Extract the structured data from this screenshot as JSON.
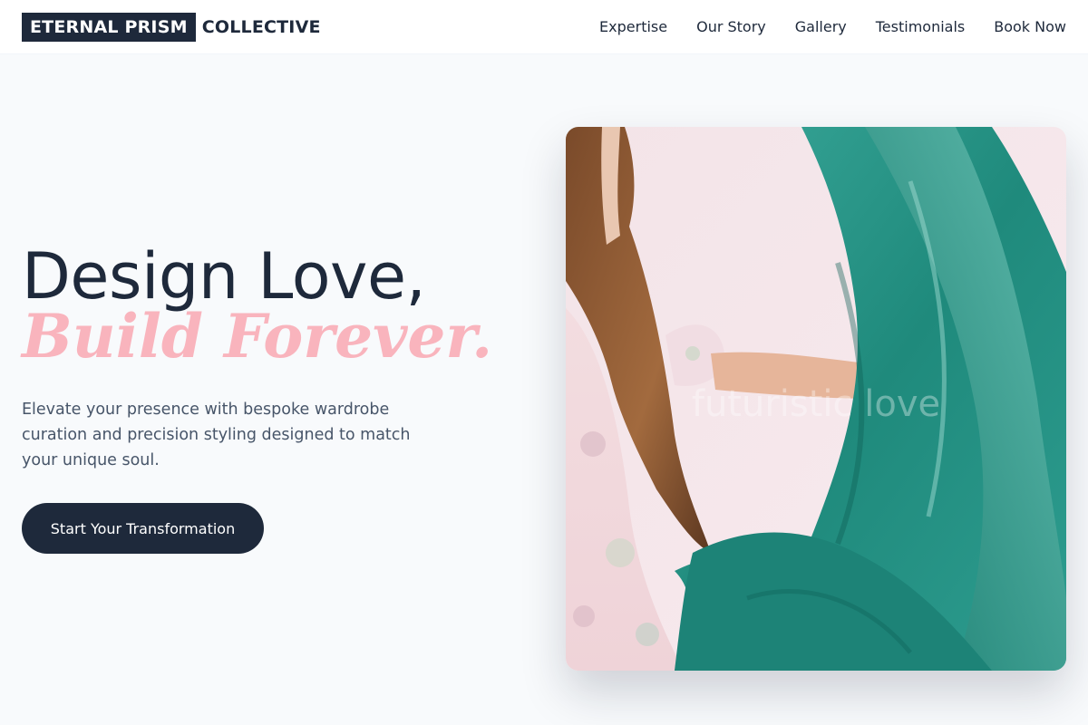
{
  "brand": {
    "logo_box": "ETERNAL PRISM",
    "logo_rest": "COLLECTIVE"
  },
  "nav": {
    "items": [
      {
        "label": "Expertise"
      },
      {
        "label": "Our Story"
      },
      {
        "label": "Gallery"
      },
      {
        "label": "Testimonials"
      },
      {
        "label": "Book Now"
      }
    ]
  },
  "hero": {
    "headline_line1": "Design Love,",
    "headline_line2": "Build Forever.",
    "description": "Elevate your presence with bespoke wardrobe curation and precision styling designed to match your unique soul.",
    "cta_label": "Start Your Transformation",
    "image_watermark": "futuristic love"
  },
  "colors": {
    "primary_dark": "#1e293b",
    "accent_pink": "#f9b4bd",
    "background": "#f8fafc",
    "fabric_teal": "#1f8a7c"
  }
}
